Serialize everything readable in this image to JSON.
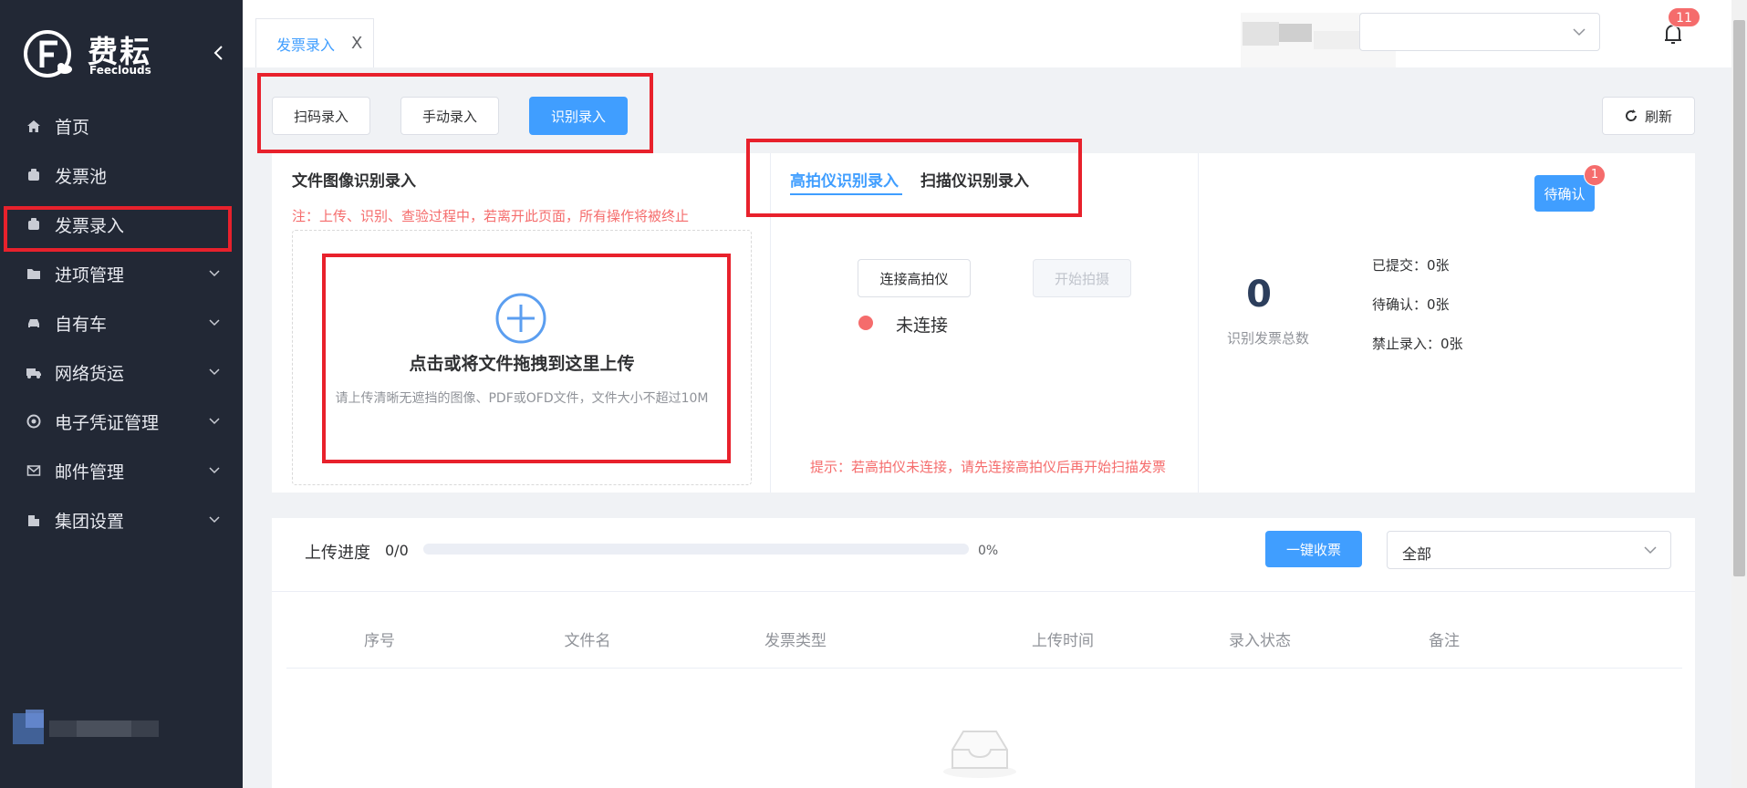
{
  "brand": {
    "name_cn": "费耘",
    "name_en": "Feeclouds"
  },
  "sidebar": {
    "items": [
      {
        "label": "首页"
      },
      {
        "label": "发票池"
      },
      {
        "label": "发票录入"
      },
      {
        "label": "进项管理"
      },
      {
        "label": "自有车"
      },
      {
        "label": "网络货运"
      },
      {
        "label": "电子凭证管理"
      },
      {
        "label": "邮件管理"
      },
      {
        "label": "集团设置"
      }
    ]
  },
  "header": {
    "tab_label": "发票录入",
    "tab_close": "X",
    "notification_count": "11"
  },
  "toolbar": {
    "scan_code": "扫码录入",
    "manual": "手动录入",
    "recognize": "识别录入",
    "refresh": "刷新"
  },
  "upload": {
    "title": "文件图像识别录入",
    "note": "注：上传、识别、查验过程中，若离开此页面，所有操作将被终止",
    "drop_text": "点击或将文件拖拽到这里上传",
    "drop_hint": "请上传清晰无遮挡的图像、PDF或OFD文件，文件大小不超过10M"
  },
  "camera": {
    "tab_active": "高拍仪识别录入",
    "tab_other": "扫描仪识别录入",
    "connect_button": "连接高拍仪",
    "shoot_button": "开始拍摄",
    "status": "未连接",
    "hint": "提示：若高拍仪未连接，请先连接高拍仪后再开始扫描发票"
  },
  "stats": {
    "pending_button": "待确认",
    "pending_badge": "1",
    "total": "0",
    "total_label": "识别发票总数",
    "submitted": "已提交：0张",
    "to_confirm": "待确认：0张",
    "blocked": "禁止录入：0张"
  },
  "progress": {
    "label": "上传进度",
    "count": "0/0",
    "fraction": 0,
    "percent": "0%",
    "collect_button": "一键收票",
    "filter_value": "全部"
  },
  "table": {
    "columns": [
      "序号",
      "文件名",
      "发票类型",
      "上传时间",
      "录入状态",
      "备注"
    ]
  },
  "colors": {
    "primary": "#409eff",
    "danger": "#f56c6c",
    "sidebar": "#222835",
    "annotation": "#e8212c"
  }
}
